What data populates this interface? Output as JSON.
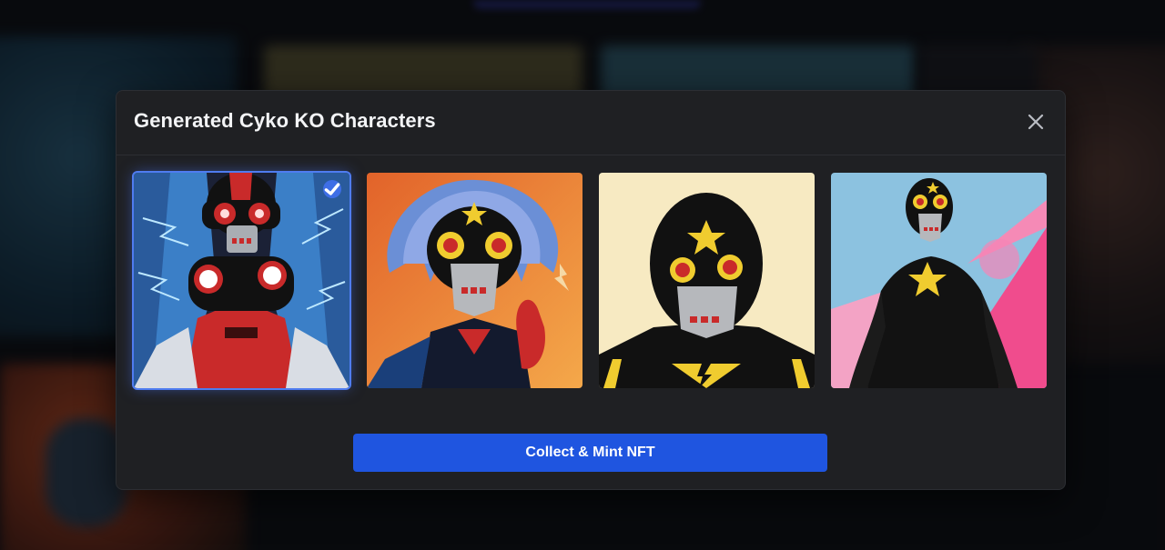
{
  "modal": {
    "title": "Generated Cyko KO Characters",
    "close_icon": "close-icon",
    "selected_index": 0,
    "characters": [
      {
        "selected": true
      },
      {
        "selected": false
      },
      {
        "selected": false
      },
      {
        "selected": false
      }
    ],
    "mint_button_label": "Collect & Mint NFT"
  },
  "colors": {
    "accent": "#1f55e0",
    "modal_bg": "#1f2023",
    "selection": "#4f7cf0"
  }
}
